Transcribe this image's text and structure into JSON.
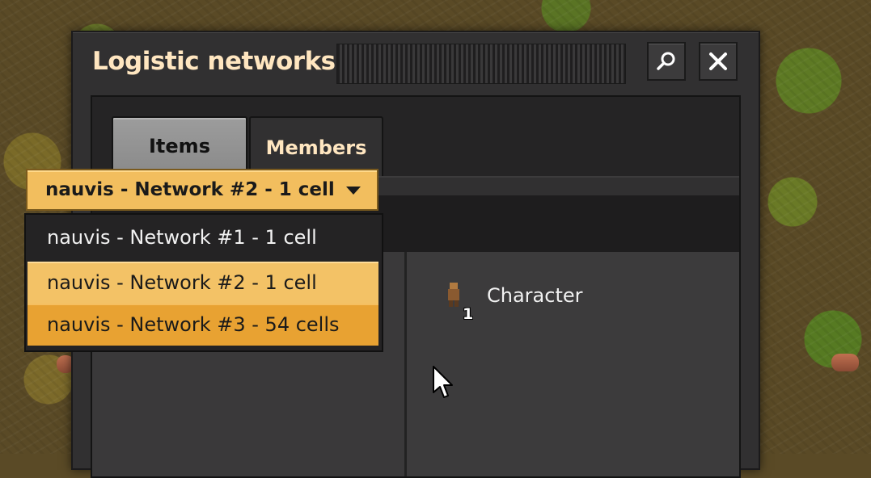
{
  "window": {
    "title": "Logistic networks"
  },
  "toolbar": {
    "search_icon": "search-icon",
    "close_icon": "close-icon"
  },
  "tabs": [
    {
      "label": "Items",
      "active": false
    },
    {
      "label": "Members",
      "active": true
    }
  ],
  "network_selector": {
    "selected": "nauvis - Network #2 - 1 cell",
    "options": [
      "nauvis - Network #1 - 1 cell",
      "nauvis - Network #2 - 1 cell",
      "nauvis - Network #3 - 54 cells"
    ],
    "hovered_index": 2
  },
  "members": [
    {
      "icon": "character-icon",
      "count": "1",
      "name": "Character"
    }
  ],
  "colors": {
    "accent": "#f2be5e",
    "hover": "#e8a232",
    "title": "#ffe6c0",
    "panel": "#313031"
  }
}
